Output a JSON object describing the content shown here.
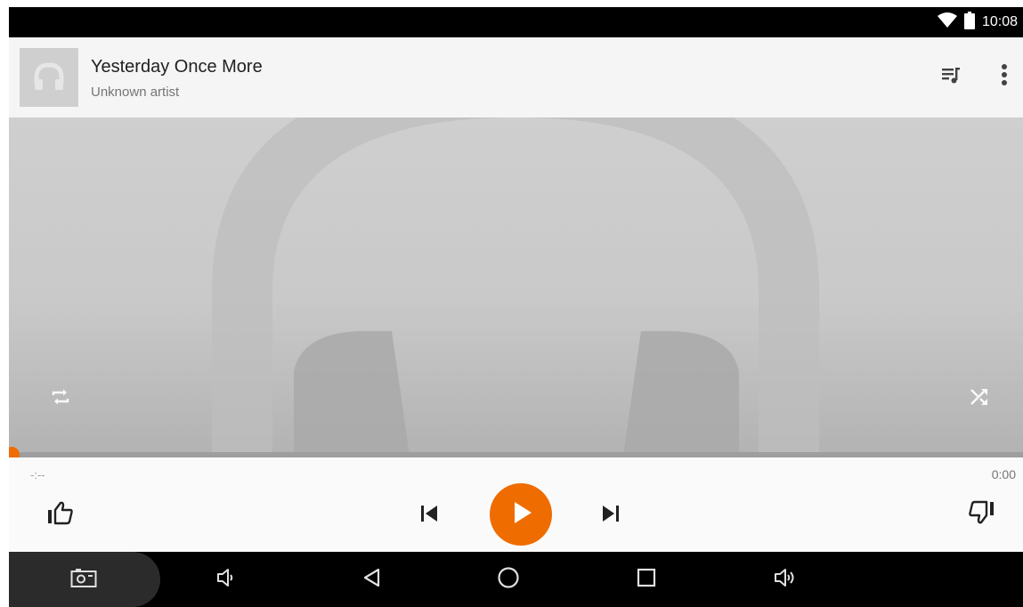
{
  "status_bar": {
    "time": "10:08",
    "wifi_icon": "wifi-icon",
    "battery_icon": "battery-icon"
  },
  "now_playing": {
    "title": "Yesterday Once More",
    "artist": "Unknown artist"
  },
  "header_actions": {
    "queue_icon": "queue-music-icon",
    "more_icon": "more-vert-icon"
  },
  "player": {
    "progress_fraction": 0.0,
    "time_elapsed": "-:--",
    "time_total": "0:00",
    "accent_color": "#ef6c00"
  },
  "controls": {
    "repeat_icon": "repeat-icon",
    "shuffle_icon": "shuffle-icon",
    "thumb_up_icon": "thumb-up-icon",
    "thumb_down_icon": "thumb-down-icon",
    "prev_icon": "skip-previous-icon",
    "play_icon": "play-icon",
    "next_icon": "skip-next-icon"
  },
  "nav_bar": {
    "icons": [
      "screenshot-icon",
      "volume-down-icon",
      "back-icon",
      "home-icon",
      "recents-icon",
      "volume-up-icon"
    ]
  }
}
